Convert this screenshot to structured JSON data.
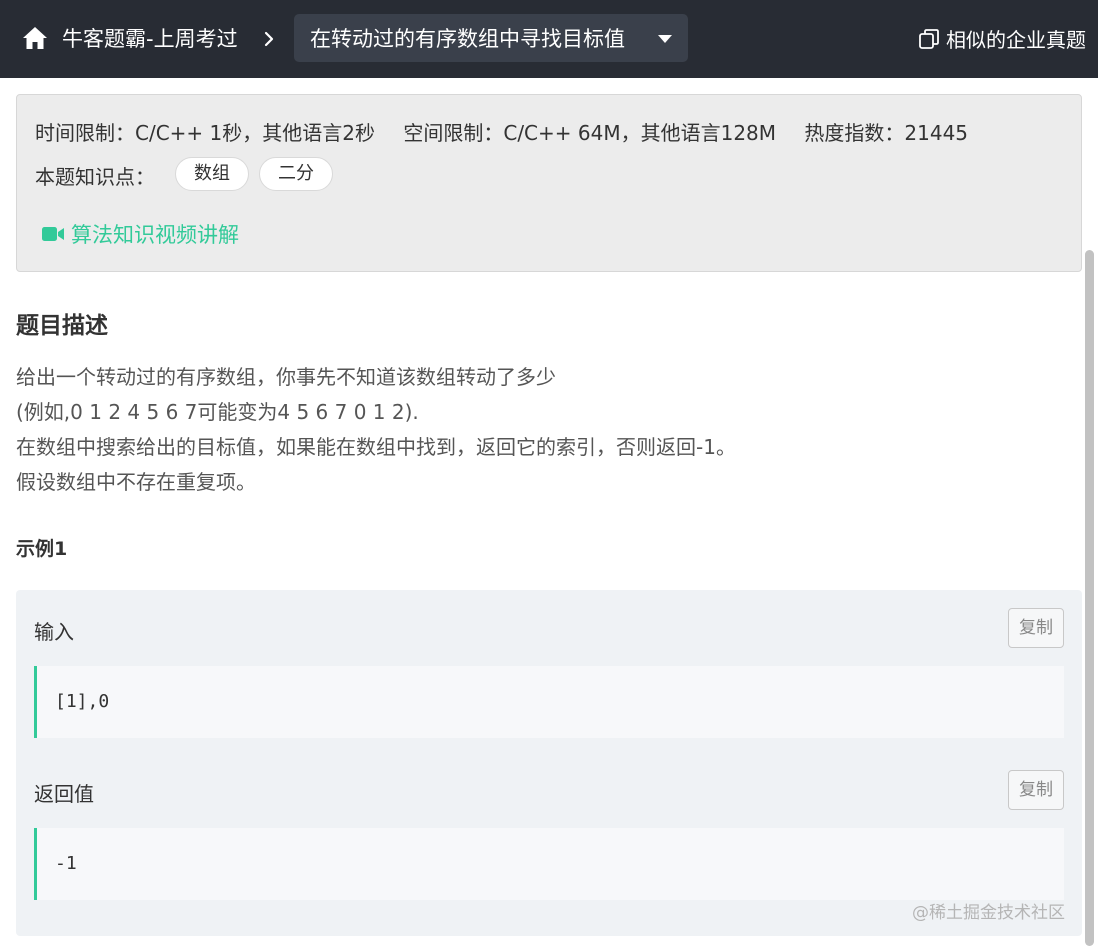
{
  "header": {
    "breadcrumb_home": "牛客题霸-上周考过",
    "problem_title": "在转动过的有序数组中寻找目标值",
    "similar_label": "相似的企业真题"
  },
  "info": {
    "time_limit": "时间限制：C/C++ 1秒，其他语言2秒",
    "space_limit": "空间限制：C/C++ 64M，其他语言128M",
    "heat": "热度指数：21445",
    "knowledge_label": "本题知识点：",
    "tags": [
      "数组",
      "二分"
    ],
    "video_link": "算法知识视频讲解"
  },
  "description": {
    "title": "题目描述",
    "lines": [
      "给出一个转动过的有序数组，你事先不知道该数组转动了多少",
      "(例如,0 1 2 4 5 6 7可能变为4 5 6 7 0 1 2).",
      "在数组中搜索给出的目标值，如果能在数组中找到，返回它的索引，否则返回-1。",
      "假设数组中不存在重复项。"
    ]
  },
  "example": {
    "title": "示例1",
    "input_label": "输入",
    "input_value": "[1],0",
    "output_label": "返回值",
    "output_value": "-1",
    "copy_label": "复制"
  },
  "watermark": "@稀土掘金技术社区",
  "colors": {
    "topbar": "#282c34",
    "accent": "#32ca99"
  }
}
